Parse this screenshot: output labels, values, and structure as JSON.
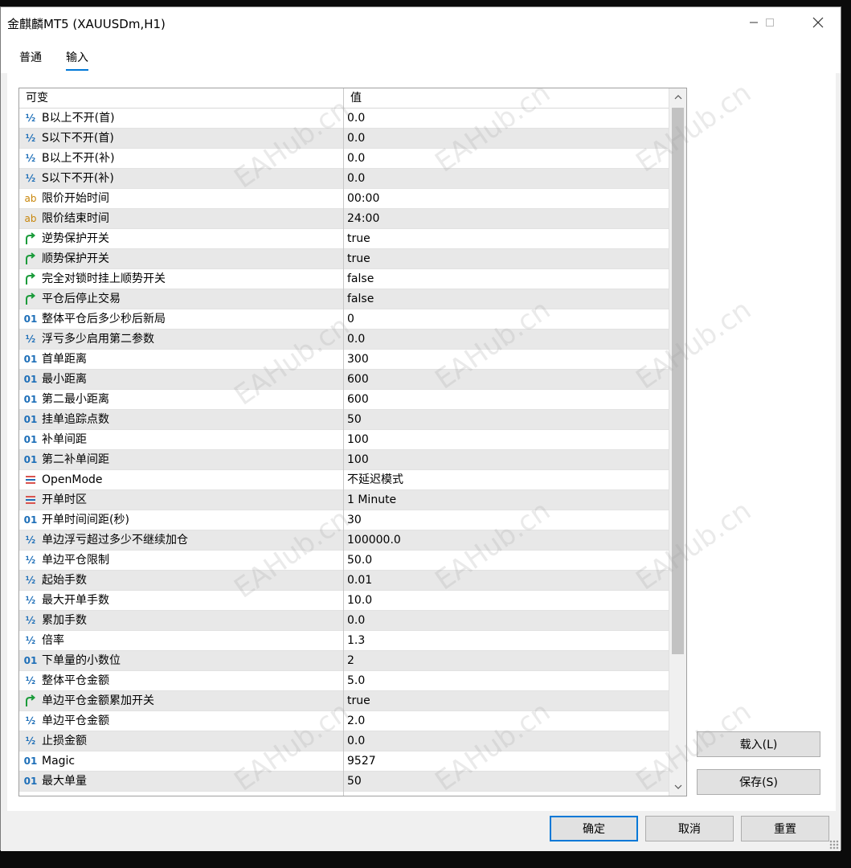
{
  "window": {
    "title": "金麒麟MT5 (XAUUSDm,H1)"
  },
  "tabs": [
    {
      "label": "普通",
      "active": false
    },
    {
      "label": "输入",
      "active": true
    }
  ],
  "grid": {
    "headers": {
      "variable": "可变",
      "value": "值"
    },
    "rows": [
      {
        "icon": "half",
        "name": "B以上不开(首)",
        "value": "0.0"
      },
      {
        "icon": "half",
        "name": "S以下不开(首)",
        "value": "0.0"
      },
      {
        "icon": "half",
        "name": "B以上不开(补)",
        "value": "0.0"
      },
      {
        "icon": "half",
        "name": "S以下不开(补)",
        "value": "0.0"
      },
      {
        "icon": "ab",
        "name": "限价开始时间",
        "value": "00:00"
      },
      {
        "icon": "ab",
        "name": "限价结束时间",
        "value": "24:00"
      },
      {
        "icon": "bool",
        "name": "逆势保护开关",
        "value": "true"
      },
      {
        "icon": "bool",
        "name": "顺势保护开关",
        "value": "true"
      },
      {
        "icon": "bool",
        "name": "完全对锁时挂上顺势开关",
        "value": "false"
      },
      {
        "icon": "bool",
        "name": "平仓后停止交易",
        "value": "false"
      },
      {
        "icon": "int",
        "name": "整体平仓后多少秒后新局",
        "value": "0"
      },
      {
        "icon": "half",
        "name": "浮亏多少启用第二参数",
        "value": "0.0"
      },
      {
        "icon": "int",
        "name": "首单距离",
        "value": "300"
      },
      {
        "icon": "int",
        "name": "最小距离",
        "value": "600"
      },
      {
        "icon": "int",
        "name": "第二最小距离",
        "value": "600"
      },
      {
        "icon": "int",
        "name": "挂单追踪点数",
        "value": "50"
      },
      {
        "icon": "int",
        "name": "补单间距",
        "value": "100"
      },
      {
        "icon": "int",
        "name": "第二补单间距",
        "value": "100"
      },
      {
        "icon": "enum",
        "name": "OpenMode",
        "value": "不延迟模式"
      },
      {
        "icon": "enum",
        "name": "开单时区",
        "value": "1 Minute"
      },
      {
        "icon": "int",
        "name": "开单时间间距(秒)",
        "value": "30"
      },
      {
        "icon": "half",
        "name": "单边浮亏超过多少不继续加仓",
        "value": "100000.0"
      },
      {
        "icon": "half",
        "name": "单边平仓限制",
        "value": "50.0"
      },
      {
        "icon": "half",
        "name": "起始手数",
        "value": "0.01"
      },
      {
        "icon": "half",
        "name": "最大开单手数",
        "value": "10.0"
      },
      {
        "icon": "half",
        "name": "累加手数",
        "value": "0.0"
      },
      {
        "icon": "half",
        "name": "倍率",
        "value": "1.3"
      },
      {
        "icon": "int",
        "name": "下单量的小数位",
        "value": "2"
      },
      {
        "icon": "half",
        "name": "整体平仓金额",
        "value": "5.0"
      },
      {
        "icon": "bool",
        "name": "单边平仓金额累加开关",
        "value": "true"
      },
      {
        "icon": "half",
        "name": "单边平仓金额",
        "value": "2.0"
      },
      {
        "icon": "half",
        "name": "止损金额",
        "value": "0.0"
      },
      {
        "icon": "int",
        "name": "Magic",
        "value": "9527"
      },
      {
        "icon": "int",
        "name": "最大单量",
        "value": "50"
      }
    ]
  },
  "icons": {
    "half_glyph": "½",
    "ab_glyph": "ab",
    "int_glyph": "01",
    "bool_color": "#1a9b3a",
    "enum_colors": [
      "#d9534f",
      "#1e6fb8",
      "#d9534f"
    ]
  },
  "side_buttons": {
    "load": "载入(L)",
    "save": "保存(S)"
  },
  "footer_buttons": {
    "ok": "确定",
    "cancel": "取消",
    "reset": "重置"
  },
  "watermark": "EAHub.cn"
}
